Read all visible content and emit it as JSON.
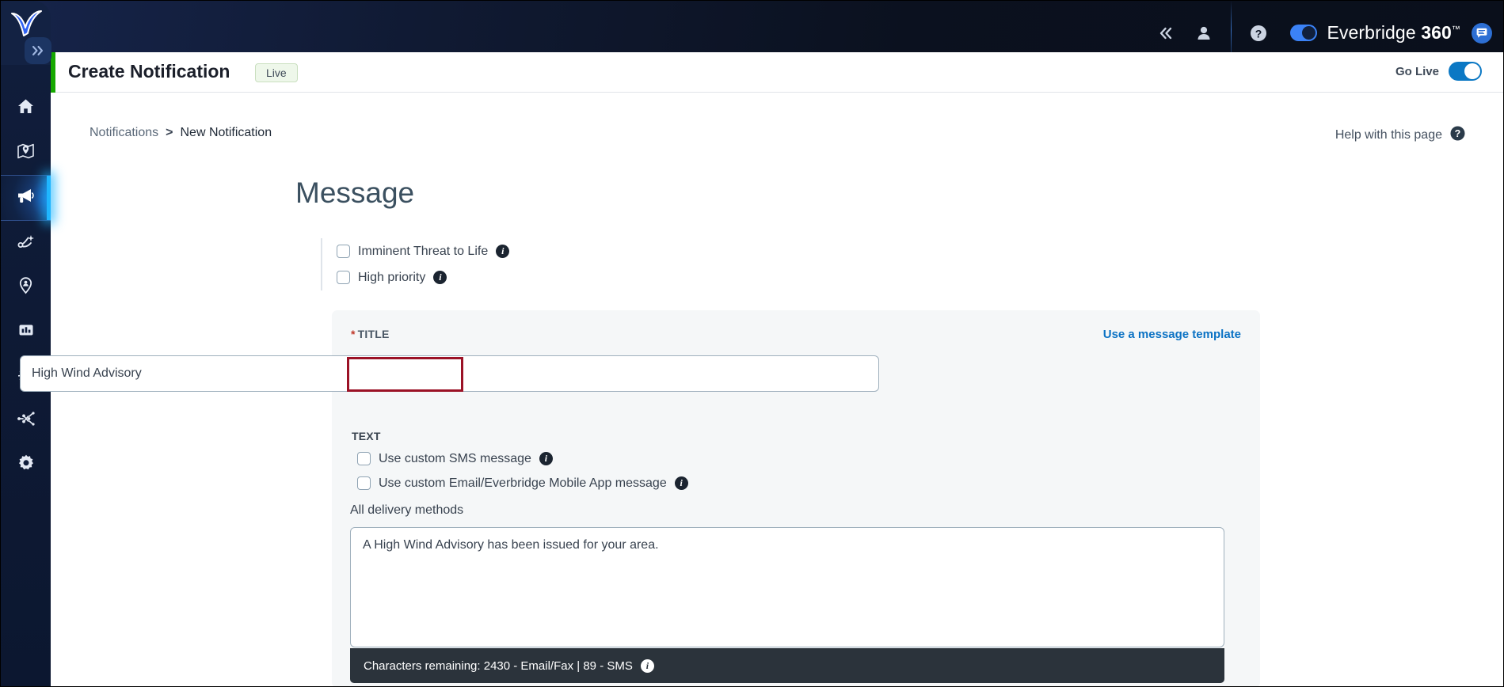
{
  "topbar": {
    "logo_name": "everbridge-logo",
    "collapse_label": "«",
    "icons": [
      {
        "name": "collapse-panel-icon",
        "glyph": "«"
      },
      {
        "name": "user-account-icon",
        "glyph": "person"
      },
      {
        "name": "help-icon",
        "glyph": "?"
      }
    ],
    "brand_prefix": "Everbridge ",
    "brand_number": "360",
    "brand_tm": "™",
    "chat_icon_name": "chat-icon"
  },
  "sidebar": {
    "items": [
      {
        "name": "sidebar-item-home",
        "icon": "home-icon",
        "active": false
      },
      {
        "name": "sidebar-item-map",
        "icon": "map-location-icon",
        "active": false
      },
      {
        "name": "sidebar-item-notifications",
        "icon": "megaphone-icon",
        "active": true
      },
      {
        "name": "sidebar-item-workflows",
        "icon": "workflow-branch-icon",
        "active": false
      },
      {
        "name": "sidebar-item-travel-risk",
        "icon": "map-pin-person-icon",
        "active": false
      },
      {
        "name": "sidebar-item-reports",
        "icon": "bar-chart-icon",
        "active": false
      },
      {
        "name": "sidebar-item-travel",
        "icon": "airplane-icon",
        "active": false
      },
      {
        "name": "sidebar-item-integrations",
        "icon": "network-nodes-icon",
        "active": false
      },
      {
        "name": "sidebar-item-settings",
        "icon": "gear-icon",
        "active": false
      }
    ]
  },
  "page_header": {
    "title": "Create Notification",
    "badge": "Live",
    "go_live_label": "Go Live",
    "go_live_on": true,
    "accent_color": "#16a800"
  },
  "breadcrumb": {
    "parent": "Notifications",
    "separator": ">",
    "current": "New Notification"
  },
  "help": {
    "label": "Help with this page"
  },
  "main": {
    "heading": "Message",
    "priority_checks": [
      {
        "label": "Imminent Threat to Life",
        "checked": false
      },
      {
        "label": "High priority",
        "checked": false
      }
    ],
    "title_field": {
      "label": "TITLE",
      "required_marker": "*",
      "value": "High Wind Advisory",
      "placeholder": ""
    },
    "template_link": "Use a message template",
    "text_section": {
      "label": "TEXT",
      "checks": [
        {
          "label": "Use custom SMS message",
          "checked": false
        },
        {
          "label": "Use custom Email/Everbridge Mobile App message",
          "checked": false
        }
      ],
      "delivery_label": "All delivery methods",
      "body_value": "A High Wind Advisory has been issued for your area.",
      "body_placeholder": "",
      "counter": "Characters remaining: 2430 - Email/Fax  |  89 - SMS"
    }
  },
  "annotation": {
    "highlight_color": "#9b1226",
    "target": "title-input-value"
  }
}
